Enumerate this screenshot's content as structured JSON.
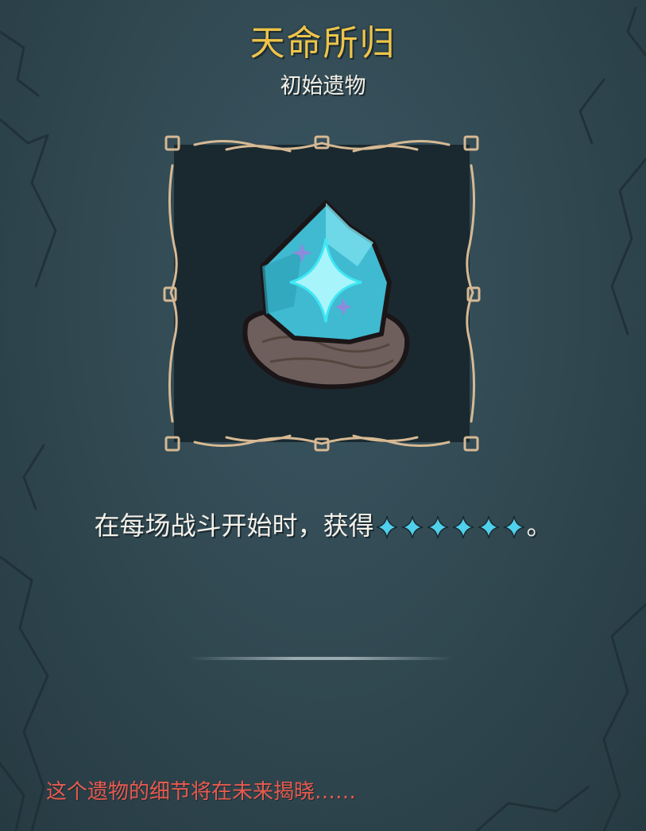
{
  "relic": {
    "name": "天命所归",
    "rarity": "初始遗物",
    "description_prefix": "在每场战斗开始时，获得",
    "energy_icon": "energy-star-icon",
    "energy_amount": 6,
    "description_suffix": "。",
    "image": "blue-crystal-on-rock-icon"
  },
  "note": {
    "text": "这个遗物的细节将在未来揭晓……"
  },
  "colors": {
    "title": "#eec54a",
    "subtitle": "#f2efe6",
    "background": "#30474f",
    "frame": "#d6b994",
    "energy": "#4fd0ec",
    "warning": "#e85a4f"
  }
}
